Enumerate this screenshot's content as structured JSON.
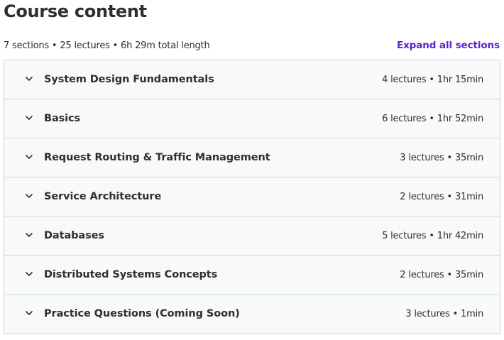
{
  "header": {
    "title": "Course content",
    "summary": "7 sections • 25 lectures • 6h 29m total length",
    "expand_all_label": "Expand all sections"
  },
  "colors": {
    "accent": "#5624d0",
    "text": "#2d2f31",
    "border": "#d1d7dc",
    "section_bg": "#f7f9fa"
  },
  "sections": [
    {
      "title": "System Design Fundamentals",
      "meta": "4 lectures • 1hr 15min",
      "icon": "chevron-down-icon"
    },
    {
      "title": "Basics",
      "meta": "6 lectures • 1hr 52min",
      "icon": "chevron-down-icon"
    },
    {
      "title": "Request Routing & Traffic Management",
      "meta": "3 lectures • 35min",
      "icon": "chevron-down-icon"
    },
    {
      "title": "Service Architecture",
      "meta": "2 lectures • 31min",
      "icon": "chevron-down-icon"
    },
    {
      "title": "Databases",
      "meta": "5 lectures • 1hr 42min",
      "icon": "chevron-down-icon"
    },
    {
      "title": "Distributed Systems Concepts",
      "meta": "2 lectures • 35min",
      "icon": "chevron-down-icon"
    },
    {
      "title": "Practice Questions (Coming Soon)",
      "meta": "3 lectures • 1min",
      "icon": "chevron-down-icon"
    }
  ]
}
